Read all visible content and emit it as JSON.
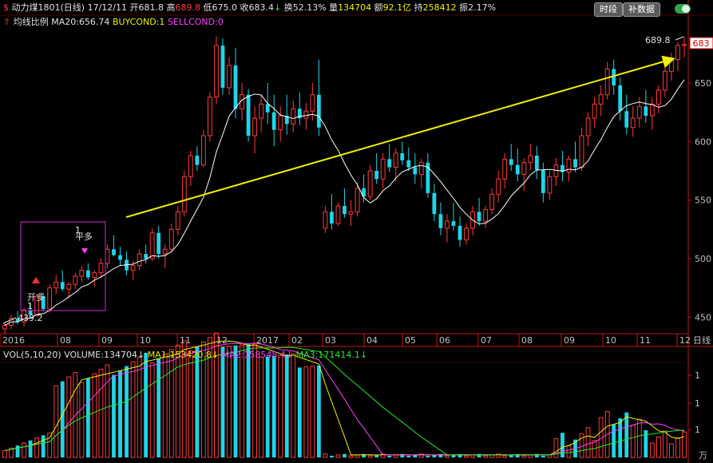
{
  "header": {
    "symbol_icon": "dollar-icon",
    "name": "动力煤1801(日线)",
    "date": "17/12/11",
    "open_label": "开",
    "open": "681.8",
    "high_label": "高",
    "high": "689.8",
    "low_label": "低",
    "low": "675.0",
    "close_label": "收",
    "close": "683.4",
    "turnover_label": "换",
    "turnover": "52.13%",
    "volume_label": "量",
    "volume": "134704",
    "amount_label": "额",
    "amount": "92.1亿",
    "position_label": "持",
    "position": "258412",
    "amplitude_label": "振",
    "amplitude": "2.17%",
    "btn_period": "时段",
    "btn_supplement": "补数据"
  },
  "indicator": {
    "name": "均线比例",
    "ma_label": "MA20:",
    "ma_value": "656.74",
    "buy_label": "BUYCOND:",
    "buy_value": "1",
    "sell_label": "SELLCOND:",
    "sell_value": "0"
  },
  "volume_info": {
    "params": "VOL(5,10,20)",
    "vol_label": "VOLUME:",
    "vol_value": "134704",
    "ma1_label": "MA1:",
    "ma1_value": "153420.8",
    "ma2_label": "MA2:",
    "ma2_value": "158548.4",
    "ma3_label": "MA3:",
    "ma3_value": "171414.1"
  },
  "annotations": {
    "low_price": "439.2",
    "high_price": "689.8",
    "last_price": "683",
    "open_long": "开多",
    "level_1": "1",
    "exit_long": "平多",
    "exit_level": "1",
    "period_label": "日线",
    "unit_label": "万"
  },
  "colors": {
    "up": "#ff3b3b",
    "down": "#1fd4e6",
    "ma": "#ffffff",
    "trend": "#f0f000",
    "vol_ma1": "#f0f000",
    "vol_ma2": "#ff40ff",
    "vol_ma3": "#22ee22",
    "axis": "#c01818"
  },
  "chart_data": {
    "type": "candlestick",
    "title": "动力煤1801(日线)",
    "y_ticks": [
      450,
      500,
      550,
      600,
      650
    ],
    "ylim": [
      440,
      695
    ],
    "volume_ticks": [
      "1",
      "1",
      "1"
    ],
    "x_ticks": [
      "2016",
      "08",
      "09",
      "10",
      "11",
      "12",
      "2017",
      "02",
      "03",
      "04",
      "05",
      "06",
      "07",
      "08",
      "09",
      "10",
      "11",
      "12"
    ],
    "ohlc": [
      [
        440,
        445,
        436,
        443
      ],
      [
        443,
        452,
        440,
        449
      ],
      [
        449,
        455,
        444,
        446
      ],
      [
        446,
        458,
        442,
        456
      ],
      [
        456,
        462,
        450,
        452
      ],
      [
        452,
        470,
        450,
        468
      ],
      [
        468,
        471,
        455,
        457
      ],
      [
        457,
        478,
        454,
        475
      ],
      [
        475,
        486,
        470,
        480
      ],
      [
        480,
        490,
        472,
        474
      ],
      [
        474,
        480,
        466,
        478
      ],
      [
        478,
        488,
        474,
        485
      ],
      [
        485,
        494,
        480,
        490
      ],
      [
        490,
        496,
        482,
        484
      ],
      [
        484,
        490,
        476,
        488
      ],
      [
        488,
        500,
        484,
        496
      ],
      [
        496,
        512,
        492,
        508
      ],
      [
        508,
        520,
        502,
        503
      ],
      [
        503,
        510,
        494,
        499
      ],
      [
        499,
        506,
        486,
        490
      ],
      [
        490,
        498,
        482,
        494
      ],
      [
        494,
        508,
        490,
        504
      ],
      [
        504,
        512,
        496,
        500
      ],
      [
        500,
        526,
        498,
        522
      ],
      [
        522,
        528,
        500,
        504
      ],
      [
        504,
        512,
        492,
        508
      ],
      [
        508,
        530,
        505,
        525
      ],
      [
        525,
        545,
        520,
        540
      ],
      [
        540,
        575,
        536,
        570
      ],
      [
        570,
        592,
        562,
        588
      ],
      [
        588,
        596,
        575,
        580
      ],
      [
        580,
        610,
        578,
        605
      ],
      [
        605,
        642,
        600,
        638
      ],
      [
        638,
        690,
        632,
        682
      ],
      [
        682,
        688,
        640,
        646
      ],
      [
        646,
        672,
        640,
        665
      ],
      [
        665,
        680,
        620,
        628
      ],
      [
        628,
        650,
        618,
        640
      ],
      [
        640,
        645,
        600,
        605
      ],
      [
        605,
        630,
        590,
        620
      ],
      [
        620,
        640,
        608,
        632
      ],
      [
        632,
        650,
        615,
        625
      ],
      [
        625,
        640,
        596,
        610
      ],
      [
        610,
        630,
        600,
        622
      ],
      [
        622,
        640,
        606,
        615
      ],
      [
        615,
        635,
        608,
        628
      ],
      [
        628,
        642,
        614,
        620
      ],
      [
        620,
        633,
        610,
        626
      ],
      [
        626,
        650,
        618,
        640
      ],
      [
        640,
        670,
        605,
        612
      ],
      [
        526,
        545,
        522,
        540
      ],
      [
        540,
        555,
        525,
        530
      ],
      [
        530,
        548,
        528,
        545
      ],
      [
        545,
        560,
        535,
        538
      ],
      [
        538,
        550,
        528,
        540
      ],
      [
        540,
        565,
        536,
        560
      ],
      [
        560,
        572,
        548,
        553
      ],
      [
        553,
        580,
        550,
        575
      ],
      [
        575,
        590,
        564,
        568
      ],
      [
        568,
        590,
        560,
        585
      ],
      [
        585,
        598,
        574,
        578
      ],
      [
        578,
        594,
        566,
        590
      ],
      [
        590,
        600,
        580,
        584
      ],
      [
        584,
        595,
        575,
        578
      ],
      [
        578,
        590,
        564,
        572
      ],
      [
        572,
        585,
        560,
        582
      ],
      [
        582,
        590,
        552,
        556
      ],
      [
        556,
        564,
        532,
        538
      ],
      [
        538,
        548,
        520,
        526
      ],
      [
        526,
        538,
        514,
        532
      ],
      [
        532,
        548,
        524,
        528
      ],
      [
        528,
        536,
        510,
        516
      ],
      [
        516,
        530,
        512,
        526
      ],
      [
        526,
        545,
        520,
        540
      ],
      [
        540,
        552,
        528,
        532
      ],
      [
        532,
        545,
        526,
        542
      ],
      [
        542,
        560,
        538,
        555
      ],
      [
        555,
        575,
        548,
        568
      ],
      [
        568,
        590,
        560,
        585
      ],
      [
        585,
        598,
        575,
        580
      ],
      [
        580,
        594,
        566,
        572
      ],
      [
        572,
        586,
        558,
        582
      ],
      [
        582,
        598,
        576,
        588
      ],
      [
        588,
        596,
        568,
        576
      ],
      [
        576,
        582,
        548,
        556
      ],
      [
        556,
        575,
        550,
        570
      ],
      [
        570,
        586,
        562,
        580
      ],
      [
        580,
        592,
        566,
        574
      ],
      [
        574,
        588,
        566,
        585
      ],
      [
        585,
        600,
        574,
        578
      ],
      [
        578,
        612,
        575,
        605
      ],
      [
        605,
        625,
        596,
        620
      ],
      [
        620,
        638,
        612,
        632
      ],
      [
        632,
        648,
        622,
        640
      ],
      [
        640,
        668,
        636,
        662
      ],
      [
        662,
        670,
        640,
        648
      ],
      [
        648,
        655,
        618,
        626
      ],
      [
        626,
        640,
        606,
        612
      ],
      [
        612,
        630,
        604,
        620
      ],
      [
        620,
        638,
        612,
        630
      ],
      [
        630,
        644,
        616,
        622
      ],
      [
        622,
        638,
        610,
        632
      ],
      [
        632,
        648,
        624,
        644
      ],
      [
        644,
        665,
        638,
        660
      ],
      [
        660,
        676,
        652,
        670
      ],
      [
        670,
        685,
        660,
        682
      ],
      [
        682,
        690,
        672,
        683
      ]
    ]
  }
}
